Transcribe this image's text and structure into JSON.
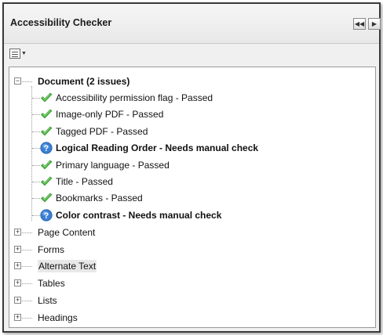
{
  "panel": {
    "title": "Accessibility Checker"
  },
  "tree": {
    "document": {
      "label": "Document (2 issues)",
      "children": [
        {
          "label": "Accessibility permission flag - Passed",
          "status": "passed"
        },
        {
          "label": "Image-only PDF - Passed",
          "status": "passed"
        },
        {
          "label": "Tagged PDF - Passed",
          "status": "passed"
        },
        {
          "label": "Logical Reading Order - Needs manual check",
          "status": "manual"
        },
        {
          "label": "Primary language - Passed",
          "status": "passed"
        },
        {
          "label": "Title - Passed",
          "status": "passed"
        },
        {
          "label": "Bookmarks - Passed",
          "status": "passed"
        },
        {
          "label": "Color contrast - Needs manual check",
          "status": "manual"
        }
      ]
    },
    "sections": [
      {
        "label": "Page Content"
      },
      {
        "label": "Forms"
      },
      {
        "label": "Alternate Text"
      },
      {
        "label": "Tables"
      },
      {
        "label": "Lists"
      },
      {
        "label": "Headings"
      }
    ]
  },
  "colors": {
    "check": "#44b53a",
    "info": "#3a7fd5"
  },
  "icons": {
    "passed": "check-icon",
    "manual": "info-icon"
  }
}
